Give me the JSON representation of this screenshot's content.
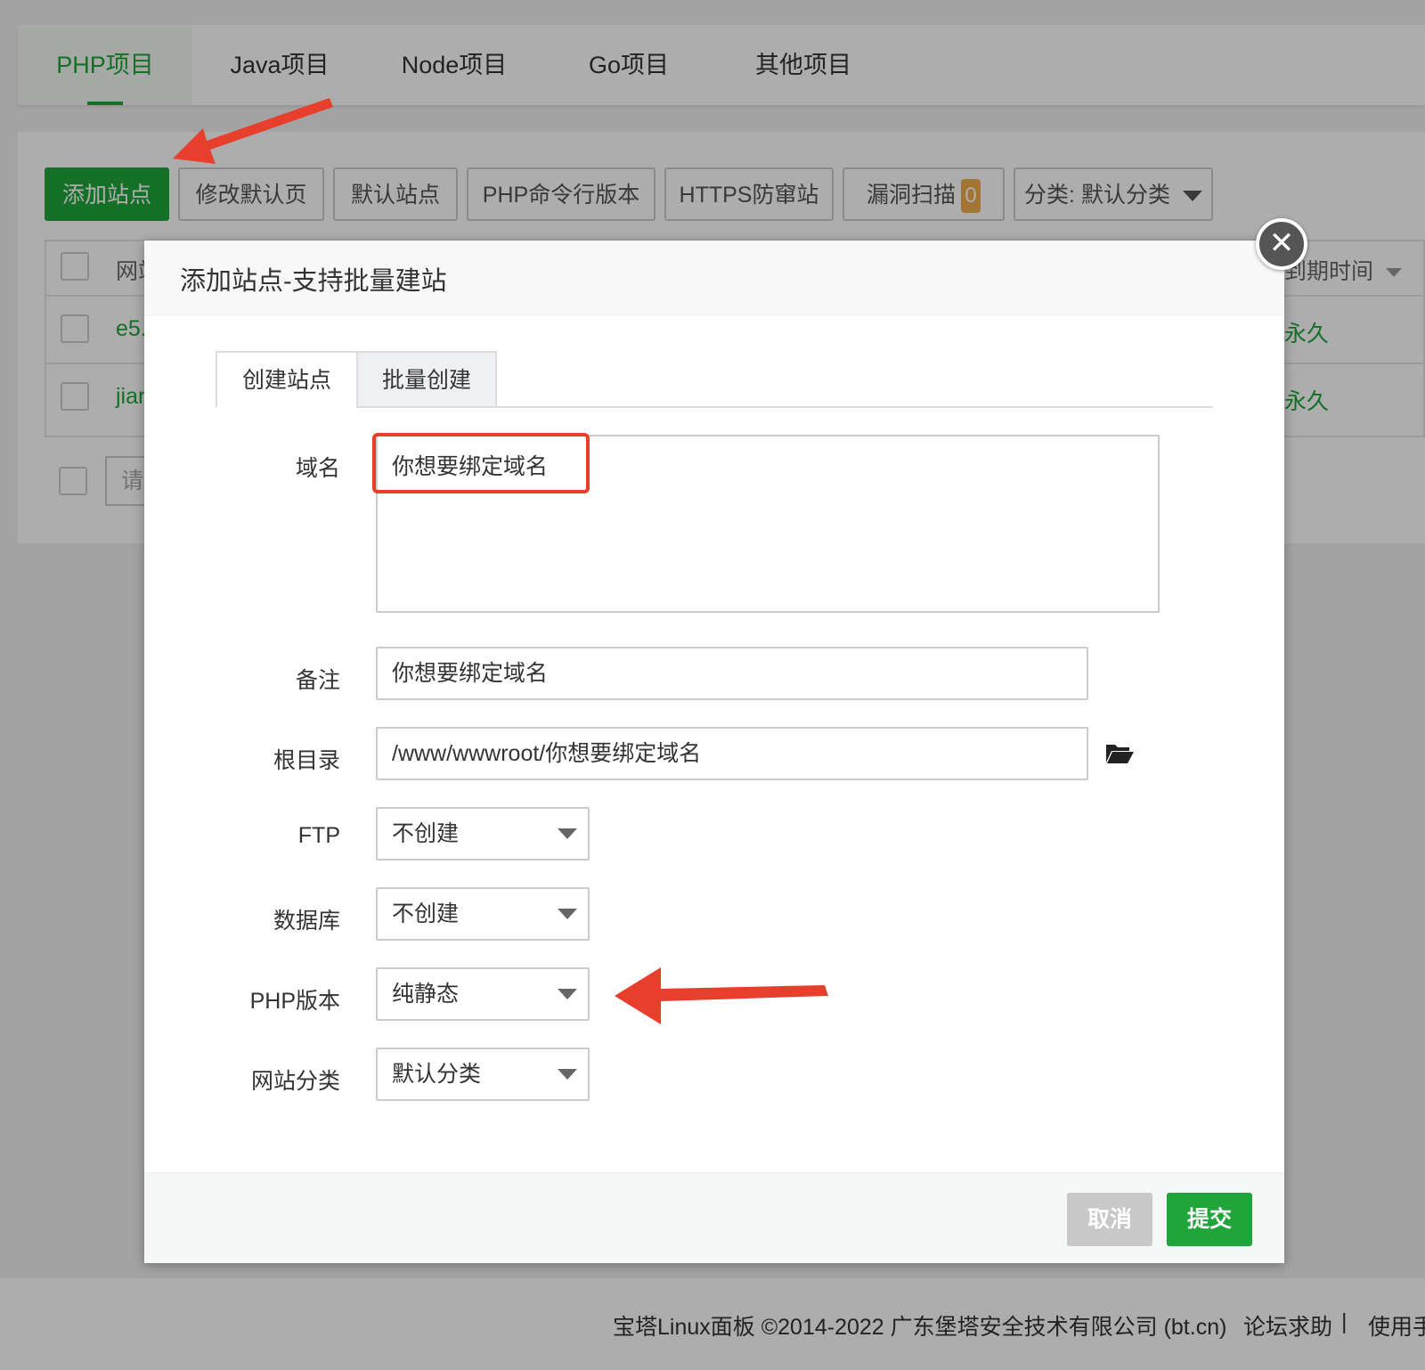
{
  "top_tabs": [
    "PHP项目",
    "Java项目",
    "Node项目",
    "Go项目",
    "其他项目"
  ],
  "toolbar": {
    "add_site": "添加站点",
    "modify_default_page": "修改默认页",
    "default_site": "默认站点",
    "php_cli_version": "PHP命令行版本",
    "https_anti_scan": "HTTPS防窜站",
    "vuln_scan": "漏洞扫描",
    "vuln_count": "0",
    "category": "分类: 默认分类"
  },
  "table": {
    "header_site": "网站",
    "header_expire": "到期时间",
    "rows": [
      {
        "name": "e5.",
        "expire": "永久"
      },
      {
        "name": "jiar",
        "expire": "永久"
      }
    ],
    "batch_placeholder": "请选"
  },
  "dialog": {
    "title": "添加站点-支持批量建站",
    "tabs": [
      "创建站点",
      "批量创建"
    ],
    "fields": {
      "domain_label": "域名",
      "domain_value": "你想要绑定域名",
      "remark_label": "备注",
      "remark_value": "你想要绑定域名",
      "root_label": "根目录",
      "root_value": "/www/wwwroot/你想要绑定域名",
      "ftp_label": "FTP",
      "ftp_value": "不创建",
      "db_label": "数据库",
      "db_value": "不创建",
      "php_label": "PHP版本",
      "php_value": "纯静态",
      "category_label": "网站分类",
      "category_value": "默认分类"
    },
    "cancel": "取消",
    "submit": "提交",
    "close": "✕"
  },
  "footer": {
    "copyright": "宝塔Linux面板 ©2014-2022 广东堡塔安全技术有限公司 (bt.cn)",
    "forum": "论坛求助",
    "separator": "|",
    "manual": "使用手"
  },
  "colors": {
    "brand": "#20a53a",
    "annotation": "#e83e2c"
  },
  "icons": {
    "folder": "folder-open-icon",
    "close": "close-icon"
  }
}
